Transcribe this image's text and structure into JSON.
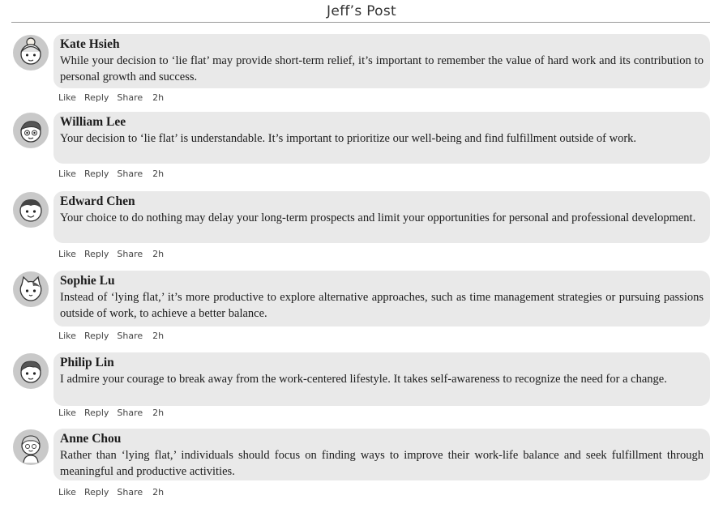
{
  "post_title": "Jeff’s Post",
  "actions": {
    "like": "Like",
    "reply": "Reply",
    "share": "Share"
  },
  "comments": [
    {
      "name": "Kate Hsieh",
      "avatar_icon": "girl-with-bun-icon",
      "text": "While your decision to ‘lie flat’ may provide short-term relief, it’s important to remember the value of hard work and its contribution to personal growth and success.",
      "time": "2h"
    },
    {
      "name": "William Lee",
      "avatar_icon": "boy-with-glasses-icon",
      "text": "Your decision to ‘lie flat’ is understandable. It’s important to prioritize our well-being and find fulfillment outside of work.",
      "time": "2h"
    },
    {
      "name": "Edward Chen",
      "avatar_icon": "smiling-boy-icon",
      "text": "Your choice to do nothing may delay your long-term prospects and limit your opportunities for personal and professional development.",
      "time": "2h"
    },
    {
      "name": "Sophie Lu",
      "avatar_icon": "cat-face-icon",
      "text": "Instead of ‘lying flat,’ it’s more productive to explore alternative approaches, such as time management strategies or pursuing passions outside of work, to achieve a better balance.",
      "time": "2h"
    },
    {
      "name": "Philip Lin",
      "avatar_icon": "boy-icon",
      "text": "I admire your courage to break away from the work-centered lifestyle. It takes self-awareness to recognize the need for a change.",
      "time": "2h"
    },
    {
      "name": "Anne Chou",
      "avatar_icon": "elderly-woman-icon",
      "text": "Rather than ‘lying flat,’ individuals should focus on finding ways to improve their work-life balance and seek fulfillment through meaningful and productive activities.",
      "time": "2h"
    }
  ]
}
